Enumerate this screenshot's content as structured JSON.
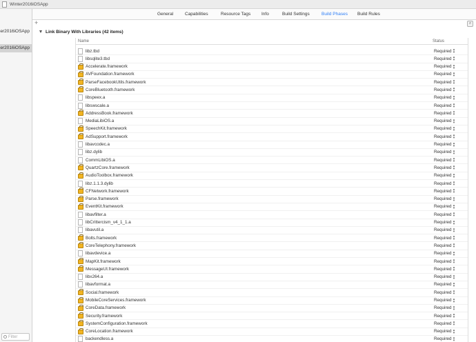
{
  "window": {
    "title": "Winter2016iOSApp"
  },
  "sidebar": {
    "items": [
      {
        "label": "er2016iOSApp",
        "selected": false
      },
      {
        "label": "er2016iOSApp",
        "selected": true
      }
    ],
    "filter_placeholder": "Filter"
  },
  "tabs": [
    {
      "label": "General",
      "active": false
    },
    {
      "label": "Capabilities",
      "active": false
    },
    {
      "label": "Resource Tags",
      "active": false
    },
    {
      "label": "Info",
      "active": false
    },
    {
      "label": "Build Settings",
      "active": false
    },
    {
      "label": "Build Phases",
      "active": true
    },
    {
      "label": "Build Rules",
      "active": false
    }
  ],
  "toolbar": {
    "add_symbol": "+"
  },
  "phase": {
    "title": "Link Binary With Libraries (42 items)"
  },
  "table": {
    "columns": {
      "name": "Name",
      "status": "Status"
    },
    "rows": [
      {
        "name": "libz.tbd",
        "kind": "library",
        "status": "Required"
      },
      {
        "name": "libsqlite3.tbd",
        "kind": "library",
        "status": "Required"
      },
      {
        "name": "Accelerate.framework",
        "kind": "framework",
        "status": "Required"
      },
      {
        "name": "AVFoundation.framework",
        "kind": "framework",
        "status": "Required"
      },
      {
        "name": "ParseFacebookUtils.framework",
        "kind": "framework",
        "status": "Required"
      },
      {
        "name": "CoreBluetooth.framework",
        "kind": "framework",
        "status": "Required"
      },
      {
        "name": "libspeex.a",
        "kind": "library",
        "status": "Required"
      },
      {
        "name": "libswscale.a",
        "kind": "library",
        "status": "Required"
      },
      {
        "name": "AddressBook.framework",
        "kind": "framework",
        "status": "Required"
      },
      {
        "name": "MediaLibiOS.a",
        "kind": "library",
        "status": "Required"
      },
      {
        "name": "SpeechKit.framework",
        "kind": "framework",
        "status": "Required"
      },
      {
        "name": "AdSupport.framework",
        "kind": "framework",
        "status": "Required"
      },
      {
        "name": "libavcodec.a",
        "kind": "library",
        "status": "Required"
      },
      {
        "name": "libz.dylib",
        "kind": "library",
        "status": "Required"
      },
      {
        "name": "CommLibiOS.a",
        "kind": "library",
        "status": "Required"
      },
      {
        "name": "QuartzCore.framework",
        "kind": "framework",
        "status": "Required"
      },
      {
        "name": "AudioToolbox.framework",
        "kind": "framework",
        "status": "Required"
      },
      {
        "name": "libz.1.1.3.dylib",
        "kind": "library",
        "status": "Required"
      },
      {
        "name": "CFNetwork.framework",
        "kind": "framework",
        "status": "Required"
      },
      {
        "name": "Parse.framework",
        "kind": "framework",
        "status": "Required"
      },
      {
        "name": "EventKit.framework",
        "kind": "framework",
        "status": "Required"
      },
      {
        "name": "libavfilter.a",
        "kind": "library",
        "status": "Required"
      },
      {
        "name": "libCrittercism_v4_1_1.a",
        "kind": "library",
        "status": "Required"
      },
      {
        "name": "libavutil.a",
        "kind": "library",
        "status": "Required"
      },
      {
        "name": "Bolts.framework",
        "kind": "framework",
        "status": "Required"
      },
      {
        "name": "CoreTelephony.framework",
        "kind": "framework",
        "status": "Required"
      },
      {
        "name": "libavdevice.a",
        "kind": "library",
        "status": "Required"
      },
      {
        "name": "MapKit.framework",
        "kind": "framework",
        "status": "Required"
      },
      {
        "name": "MessageUI.framework",
        "kind": "framework",
        "status": "Required"
      },
      {
        "name": "libx264.a",
        "kind": "library",
        "status": "Required"
      },
      {
        "name": "libavformat.a",
        "kind": "library",
        "status": "Required"
      },
      {
        "name": "Social.framework",
        "kind": "framework",
        "status": "Required"
      },
      {
        "name": "MobileCoreServices.framework",
        "kind": "framework",
        "status": "Required"
      },
      {
        "name": "CoreData.framework",
        "kind": "framework",
        "status": "Required"
      },
      {
        "name": "Security.framework",
        "kind": "framework",
        "status": "Required"
      },
      {
        "name": "SystemConfiguration.framework",
        "kind": "framework",
        "status": "Required"
      },
      {
        "name": "CoreLocation.framework",
        "kind": "framework",
        "status": "Required"
      },
      {
        "name": "backendless.a",
        "kind": "library",
        "status": "Required"
      }
    ]
  },
  "colors": {
    "accent": "#2f7ff6",
    "framework_icon": "#f2b522"
  },
  "icons": {
    "library": "document-icon",
    "framework": "toolbox-icon",
    "stepper": "up-down-stepper-icon"
  }
}
